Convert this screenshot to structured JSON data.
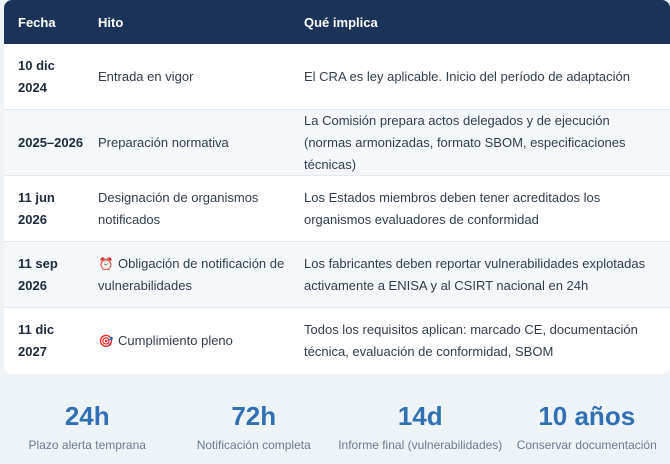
{
  "table": {
    "headers": {
      "fecha": "Fecha",
      "hito": "Hito",
      "que": "Qué implica"
    },
    "rows": [
      {
        "fecha": "10 dic 2024",
        "hito": "Entrada en vigor",
        "icon": "",
        "que": "El CRA es ley aplicable. Inicio del período de adaptación"
      },
      {
        "fecha": "2025–2026",
        "hito": "Preparación normativa",
        "icon": "",
        "que": "La Comisión prepara actos delegados y de ejecución (normas armonizadas, formato SBOM, especificaciones técnicas)"
      },
      {
        "fecha": "11 jun 2026",
        "hito": "Designación de organismos notificados",
        "icon": "",
        "que": "Los Estados miembros deben tener acreditados los organismos evaluadores de conformidad"
      },
      {
        "fecha": "11 sep 2026",
        "hito": "Obligación de notificación de vulnerabilidades",
        "icon": "⏰",
        "que": "Los fabricantes deben reportar vulnerabilidades explotadas activamente a ENISA y al CSIRT nacional en 24h"
      },
      {
        "fecha": "11 dic 2027",
        "hito": "Cumplimiento pleno",
        "icon": "🎯",
        "que": "Todos los requisitos aplican: marcado CE, documentación técnica, evaluación de conformidad, SBOM"
      }
    ]
  },
  "stats": [
    {
      "value": "24h",
      "label": "Plazo alerta temprana"
    },
    {
      "value": "72h",
      "label": "Notificación completa"
    },
    {
      "value": "14d",
      "label": "Informe final (vulnerabilidades)"
    },
    {
      "value": "10 años",
      "label": "Conservar documentación"
    }
  ]
}
